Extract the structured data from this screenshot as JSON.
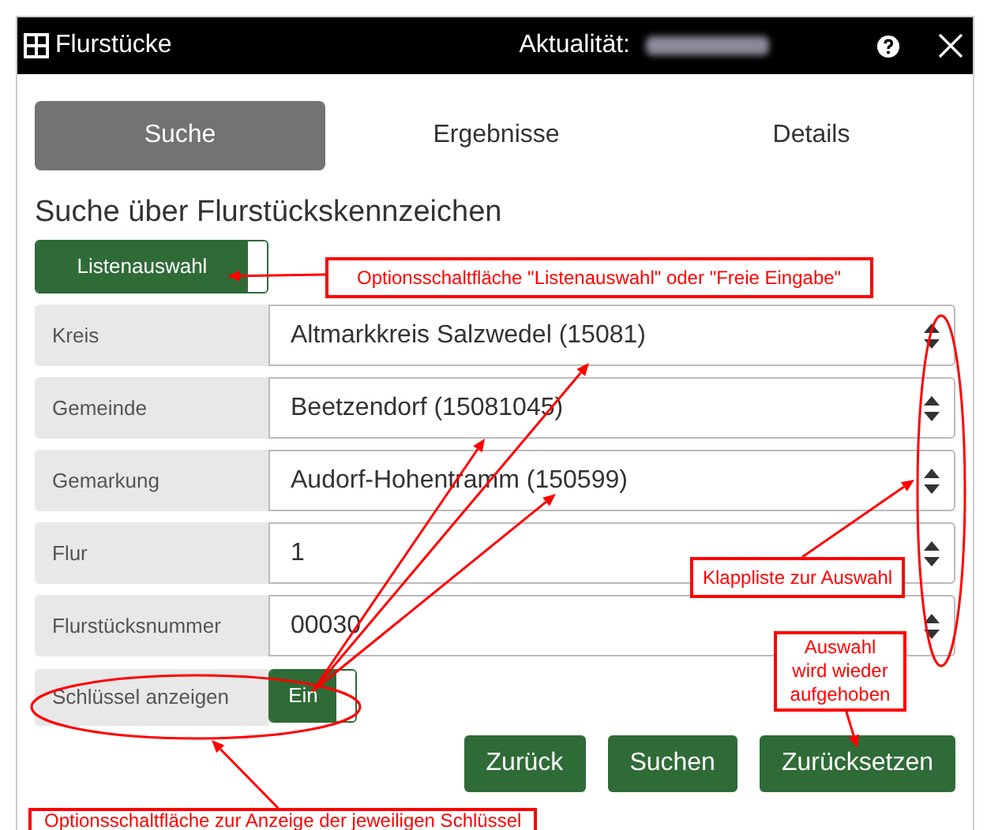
{
  "window": {
    "title": "Flurstücke",
    "currency_label": "Aktualität:"
  },
  "tabs": [
    {
      "label": "Suche",
      "selected": true
    },
    {
      "label": "Ergebnisse",
      "selected": false
    },
    {
      "label": "Details",
      "selected": false
    }
  ],
  "heading": "Suche über Flurstückskennzeichen",
  "list_toggle": {
    "label": "Listenauswahl",
    "on": true
  },
  "fields": [
    {
      "label": "Kreis",
      "value": "Altmarkkreis Salzwedel (15081)"
    },
    {
      "label": "Gemeinde",
      "value": "Beetzendorf (15081045)"
    },
    {
      "label": "Gemarkung",
      "value": "Audorf-Hohentramm (150599)"
    },
    {
      "label": "Flur",
      "value": "1"
    },
    {
      "label": "Flurstücksnummer",
      "value": "00030"
    }
  ],
  "key_toggle": {
    "label": "Schlüssel anzeigen",
    "value": "Ein",
    "on": true
  },
  "buttons": [
    "Zurück",
    "Suchen",
    "Zurücksetzen"
  ],
  "annotations": [
    "Optionsschaltfläche \"Listenauswahl\" oder \"Freie Eingabe\"",
    "Klappliste zur Auswahl",
    "Auswahl\nwird wieder\naufgehoben",
    "Optionsschaltfläche zur Anzeige der jeweiligen Schlüssel"
  ]
}
